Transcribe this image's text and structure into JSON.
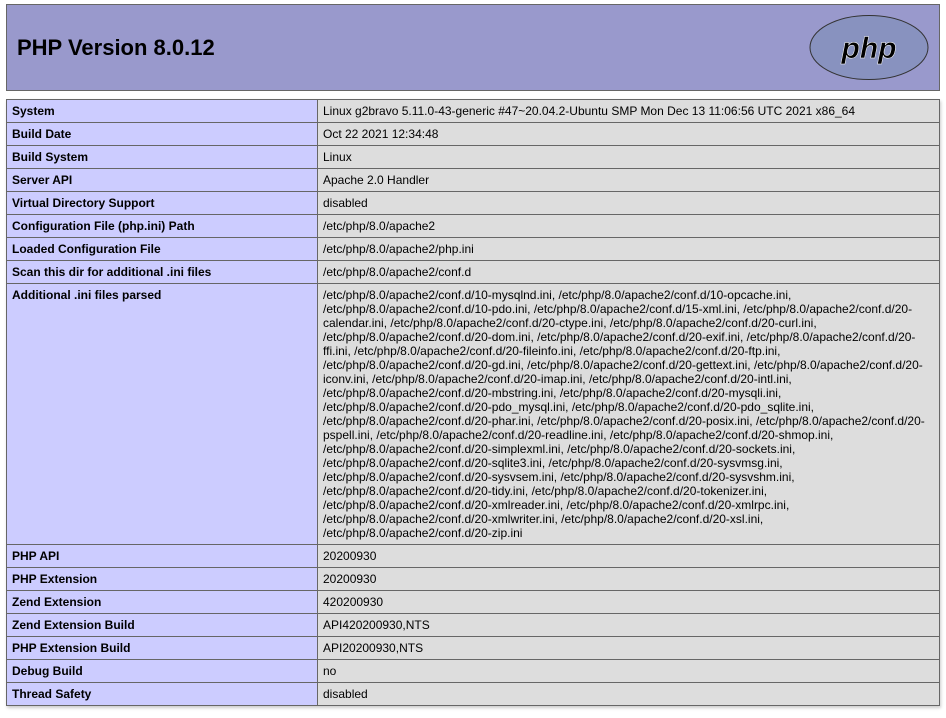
{
  "header": {
    "title": "PHP Version 8.0.12"
  },
  "rows": [
    {
      "key": "System",
      "value": "Linux g2bravo 5.11.0-43-generic #47~20.04.2-Ubuntu SMP Mon Dec 13 11:06:56 UTC 2021 x86_64"
    },
    {
      "key": "Build Date",
      "value": "Oct 22 2021 12:34:48"
    },
    {
      "key": "Build System",
      "value": "Linux"
    },
    {
      "key": "Server API",
      "value": "Apache 2.0 Handler"
    },
    {
      "key": "Virtual Directory Support",
      "value": "disabled"
    },
    {
      "key": "Configuration File (php.ini) Path",
      "value": "/etc/php/8.0/apache2"
    },
    {
      "key": "Loaded Configuration File",
      "value": "/etc/php/8.0/apache2/php.ini"
    },
    {
      "key": "Scan this dir for additional .ini files",
      "value": "/etc/php/8.0/apache2/conf.d"
    },
    {
      "key": "Additional .ini files parsed",
      "value": "/etc/php/8.0/apache2/conf.d/10-mysqlnd.ini, /etc/php/8.0/apache2/conf.d/10-opcache.ini, /etc/php/8.0/apache2/conf.d/10-pdo.ini, /etc/php/8.0/apache2/conf.d/15-xml.ini, /etc/php/8.0/apache2/conf.d/20-calendar.ini, /etc/php/8.0/apache2/conf.d/20-ctype.ini, /etc/php/8.0/apache2/conf.d/20-curl.ini, /etc/php/8.0/apache2/conf.d/20-dom.ini, /etc/php/8.0/apache2/conf.d/20-exif.ini, /etc/php/8.0/apache2/conf.d/20-ffi.ini, /etc/php/8.0/apache2/conf.d/20-fileinfo.ini, /etc/php/8.0/apache2/conf.d/20-ftp.ini, /etc/php/8.0/apache2/conf.d/20-gd.ini, /etc/php/8.0/apache2/conf.d/20-gettext.ini, /etc/php/8.0/apache2/conf.d/20-iconv.ini, /etc/php/8.0/apache2/conf.d/20-imap.ini, /etc/php/8.0/apache2/conf.d/20-intl.ini, /etc/php/8.0/apache2/conf.d/20-mbstring.ini, /etc/php/8.0/apache2/conf.d/20-mysqli.ini, /etc/php/8.0/apache2/conf.d/20-pdo_mysql.ini, /etc/php/8.0/apache2/conf.d/20-pdo_sqlite.ini, /etc/php/8.0/apache2/conf.d/20-phar.ini, /etc/php/8.0/apache2/conf.d/20-posix.ini, /etc/php/8.0/apache2/conf.d/20-pspell.ini, /etc/php/8.0/apache2/conf.d/20-readline.ini, /etc/php/8.0/apache2/conf.d/20-shmop.ini, /etc/php/8.0/apache2/conf.d/20-simplexml.ini, /etc/php/8.0/apache2/conf.d/20-sockets.ini, /etc/php/8.0/apache2/conf.d/20-sqlite3.ini, /etc/php/8.0/apache2/conf.d/20-sysvmsg.ini, /etc/php/8.0/apache2/conf.d/20-sysvsem.ini, /etc/php/8.0/apache2/conf.d/20-sysvshm.ini, /etc/php/8.0/apache2/conf.d/20-tidy.ini, /etc/php/8.0/apache2/conf.d/20-tokenizer.ini, /etc/php/8.0/apache2/conf.d/20-xmlreader.ini, /etc/php/8.0/apache2/conf.d/20-xmlrpc.ini, /etc/php/8.0/apache2/conf.d/20-xmlwriter.ini, /etc/php/8.0/apache2/conf.d/20-xsl.ini, /etc/php/8.0/apache2/conf.d/20-zip.ini"
    },
    {
      "key": "PHP API",
      "value": "20200930"
    },
    {
      "key": "PHP Extension",
      "value": "20200930"
    },
    {
      "key": "Zend Extension",
      "value": "420200930"
    },
    {
      "key": "Zend Extension Build",
      "value": "API420200930,NTS"
    },
    {
      "key": "PHP Extension Build",
      "value": "API20200930,NTS"
    },
    {
      "key": "Debug Build",
      "value": "no"
    },
    {
      "key": "Thread Safety",
      "value": "disabled"
    }
  ]
}
